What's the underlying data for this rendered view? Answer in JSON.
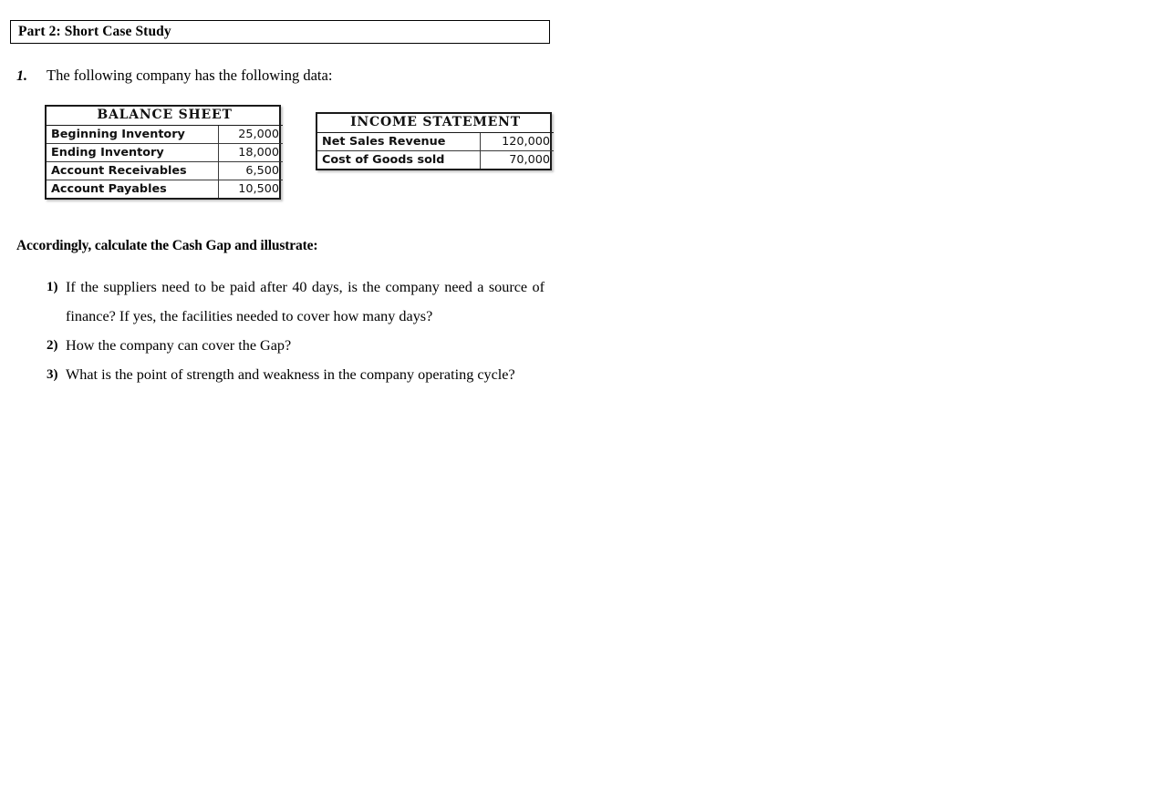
{
  "part_header": {
    "title": "Part 2: Short Case Study"
  },
  "intro": {
    "marker": "1.",
    "text": "The following company has the following data:"
  },
  "tables": {
    "balance_sheet": {
      "title": "BALANCE SHEET",
      "rows": [
        {
          "label": "Beginning Inventory",
          "value": "25,000"
        },
        {
          "label": "Ending Inventory",
          "value": "18,000"
        },
        {
          "label": "Account Receivables",
          "value": "6,500"
        },
        {
          "label": "Account Payables",
          "value": "10,500"
        }
      ]
    },
    "income_statement": {
      "title": "INCOME STATEMENT",
      "rows": [
        {
          "label": "Net Sales Revenue",
          "value": "120,000"
        },
        {
          "label": "Cost of Goods sold",
          "value": "70,000"
        }
      ]
    }
  },
  "instruction": "Accordingly, calculate the Cash Gap and illustrate:",
  "questions": [
    {
      "marker": "1)",
      "text": "If the suppliers need to be paid after 40 days, is the company need a source of finance? If yes, the facilities needed to cover how many days?"
    },
    {
      "marker": "2)",
      "text": "How the company can cover the Gap?"
    },
    {
      "marker": "3)",
      "text": "What is the point of strength and weakness in the company operating cycle?"
    }
  ]
}
